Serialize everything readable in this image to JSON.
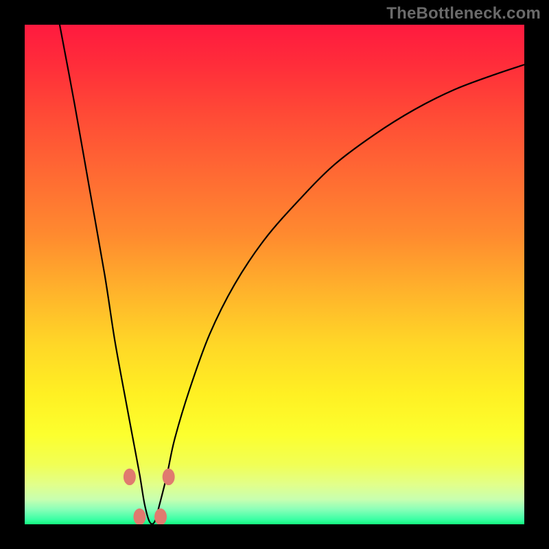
{
  "attribution": "TheBottleneck.com",
  "chart_data": {
    "type": "line",
    "title": "",
    "xlabel": "",
    "ylabel": "",
    "xlim": [
      0,
      100
    ],
    "ylim": [
      0,
      100
    ],
    "grid": false,
    "legend": false,
    "notes": "V-shaped bottleneck curve on rainbow gradient; x is normalized horizontal position, y is normalized vertical position from top (0) to bottom (100). Minimum (best) is at the valley near x≈25. Dotted salmon markers highlight ±5% bottleneck band at the valley floor and walls.",
    "series": [
      {
        "name": "bottleneck-curve",
        "x": [
          7,
          10,
          13,
          16,
          18,
          20,
          21.5,
          23,
          24,
          25,
          26,
          27,
          28.5,
          30,
          33,
          37,
          42,
          48,
          55,
          62,
          70,
          78,
          86,
          94,
          100
        ],
        "y": [
          0,
          16,
          33,
          50,
          63,
          74,
          82,
          90,
          96,
          99.5,
          99.5,
          96,
          90,
          83,
          73,
          62,
          52,
          43,
          35,
          28,
          22,
          17,
          13,
          10,
          8
        ]
      }
    ],
    "markers": [
      {
        "name": "valley-left-upper",
        "x": 21.0,
        "y": 90.5,
        "color": "#e07a6f",
        "r": 9
      },
      {
        "name": "valley-right-upper",
        "x": 28.8,
        "y": 90.5,
        "color": "#e07a6f",
        "r": 9
      },
      {
        "name": "valley-left-floor",
        "x": 23.0,
        "y": 98.5,
        "color": "#e07a6f",
        "r": 9
      },
      {
        "name": "valley-right-floor",
        "x": 27.2,
        "y": 98.5,
        "color": "#e07a6f",
        "r": 9
      }
    ],
    "gradient_stops": [
      {
        "pos": 0,
        "color": "#ff1a3f"
      },
      {
        "pos": 50,
        "color": "#ffb52b"
      },
      {
        "pos": 80,
        "color": "#fcff2e"
      },
      {
        "pos": 100,
        "color": "#13f97e"
      }
    ]
  }
}
